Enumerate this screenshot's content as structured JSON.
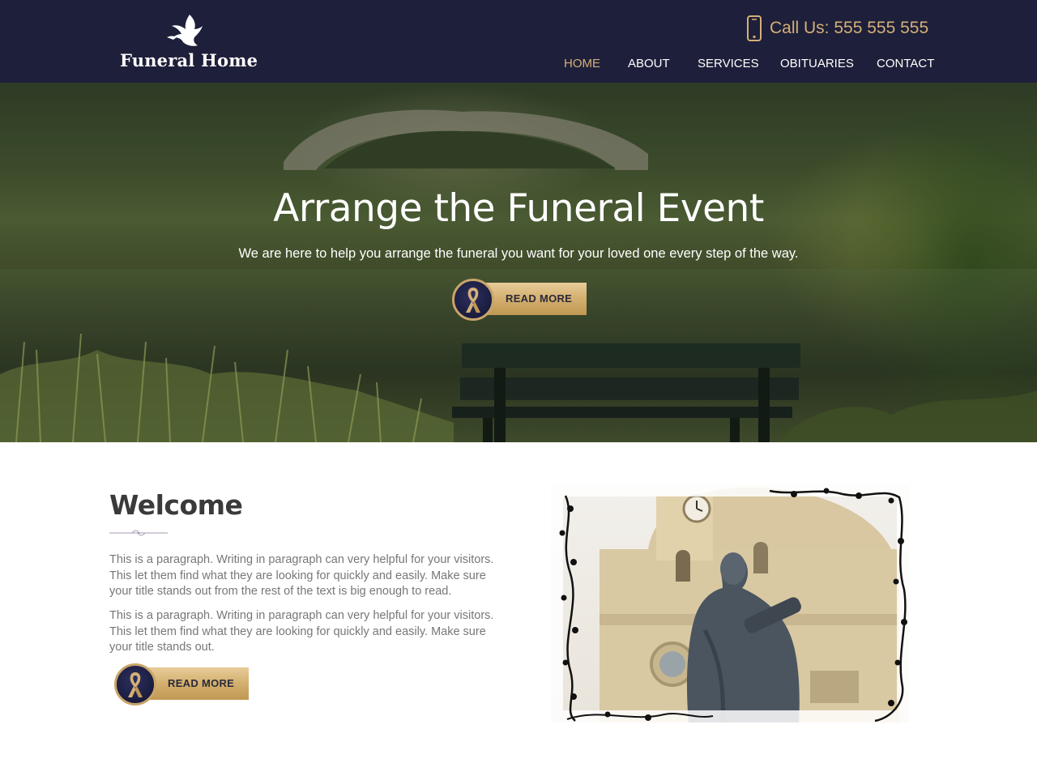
{
  "header": {
    "logo_text": "Funeral Home",
    "phone_label": "Call Us: 555 555 555",
    "phone_icon": "mobile-phone-icon",
    "logo_icon": "dove-icon",
    "bg_color": "#1e1f3a",
    "accent_color": "#d4b077"
  },
  "nav": {
    "items": [
      {
        "label": "HOME",
        "active": true
      },
      {
        "label": "ABOUT",
        "active": false
      },
      {
        "label": "SERVICES",
        "active": false
      },
      {
        "label": "OBITUARIES",
        "active": false
      },
      {
        "label": "CONTACT",
        "active": false
      }
    ]
  },
  "hero": {
    "title": "Arrange the Funeral Event",
    "subtitle": "We are here to help you arrange the funeral you want for your loved one every step of the way.",
    "button_label": "READ MORE",
    "button_icon": "awareness-ribbon-icon"
  },
  "welcome": {
    "title": "Welcome",
    "paragraph1": "This is a paragraph. Writing in paragraph can very helpful for your visitors. This let them find what they are looking for quickly and easily. Make sure your title stands out from the rest of the text is big enough to read.",
    "paragraph2": " This is a paragraph. Writing in paragraph can very helpful for your visitors. This let them find what they are looking for quickly and easily. Make sure your title stands out.",
    "button_label": "READ MORE",
    "button_icon": "awareness-ribbon-icon"
  }
}
